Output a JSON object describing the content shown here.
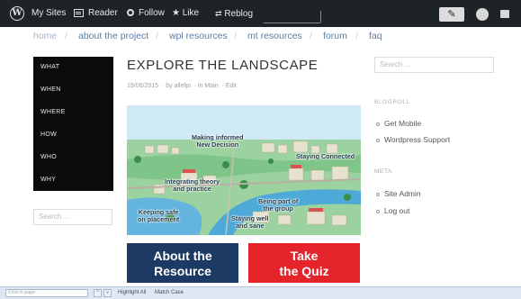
{
  "adminbar": {
    "my_sites": "My Sites",
    "reader": "Reader",
    "follow": "Follow",
    "like": "Like",
    "reblog": "Reblog"
  },
  "nav": {
    "home": "home",
    "sep": "/",
    "items": [
      "about the project",
      "wpl resources",
      "mt resources",
      "forum",
      "faq"
    ]
  },
  "left_menu": [
    "WHAT",
    "WHEN",
    "WHERE",
    "HOW",
    "WHO",
    "WHY"
  ],
  "left_search": {
    "placeholder": "Search ..."
  },
  "post": {
    "title": "EXPLORE THE LANDSCAPE",
    "date": "19/06/2015",
    "by": "by",
    "author": "allefpi",
    "in": "in",
    "category": "Main",
    "edit": "Edit"
  },
  "hero_labels": {
    "informed": "Making informed\nNew Decision",
    "connected": "Staying Connected",
    "integrating": "Integrating theory\nand practice",
    "group": "Being part of\nthe group",
    "placement": "Keeping safe\non placement",
    "sane": "Staying well\nand sane"
  },
  "cta": {
    "about_line1": "About the",
    "about_line2": "Resource",
    "quiz_line1": "Take",
    "quiz_line2": "the Quiz"
  },
  "sidebar": {
    "search_placeholder": "Search ...",
    "blogroll_heading": "BLOGROLL",
    "blogroll": [
      "Get Mobile",
      "Wordpress Support"
    ],
    "meta_heading": "META",
    "meta": [
      "Site Admin",
      "Log out"
    ]
  },
  "findbar": {
    "placeholder": "Find in page",
    "up": "^",
    "down": "v",
    "highlight_all": "Highlight All",
    "match_case": "Match Case"
  },
  "colors": {
    "adminbar": "#1d2327",
    "cta_blue": "#1c3a63",
    "cta_red": "#e5232b",
    "link": "#5b7fa6"
  }
}
